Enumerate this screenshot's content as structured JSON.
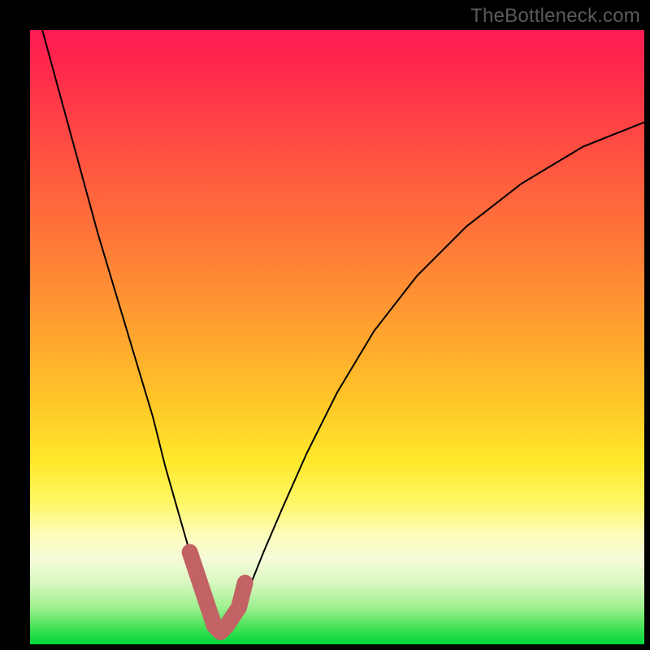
{
  "watermark": "TheBottleneck.com",
  "chart_data": {
    "type": "line",
    "title": "",
    "xlabel": "",
    "ylabel": "",
    "xlim": [
      0,
      100
    ],
    "ylim": [
      0,
      100
    ],
    "grid": false,
    "legend": false,
    "background": "rainbow-gradient-vertical",
    "series": [
      {
        "name": "bottleneck-curve",
        "x": [
          2,
          5,
          8,
          11,
          14,
          17,
          20,
          22,
          24,
          26,
          28,
          29,
          30,
          31,
          32,
          34,
          36,
          38,
          41,
          45,
          50,
          56,
          63,
          71,
          80,
          90,
          100
        ],
        "y": [
          100,
          89,
          78,
          67,
          57,
          47,
          37,
          29,
          22,
          15,
          9,
          6,
          3,
          2,
          3,
          6,
          10,
          15,
          22,
          31,
          41,
          51,
          60,
          68,
          75,
          81,
          85
        ]
      },
      {
        "name": "valley-highlight",
        "x": [
          26,
          28,
          29,
          30,
          31,
          32,
          34,
          35
        ],
        "y": [
          15,
          9,
          6,
          3,
          2,
          3,
          6,
          10
        ]
      }
    ],
    "annotations": [
      {
        "text": "TheBottleneck.com",
        "position": "top-right"
      }
    ]
  }
}
